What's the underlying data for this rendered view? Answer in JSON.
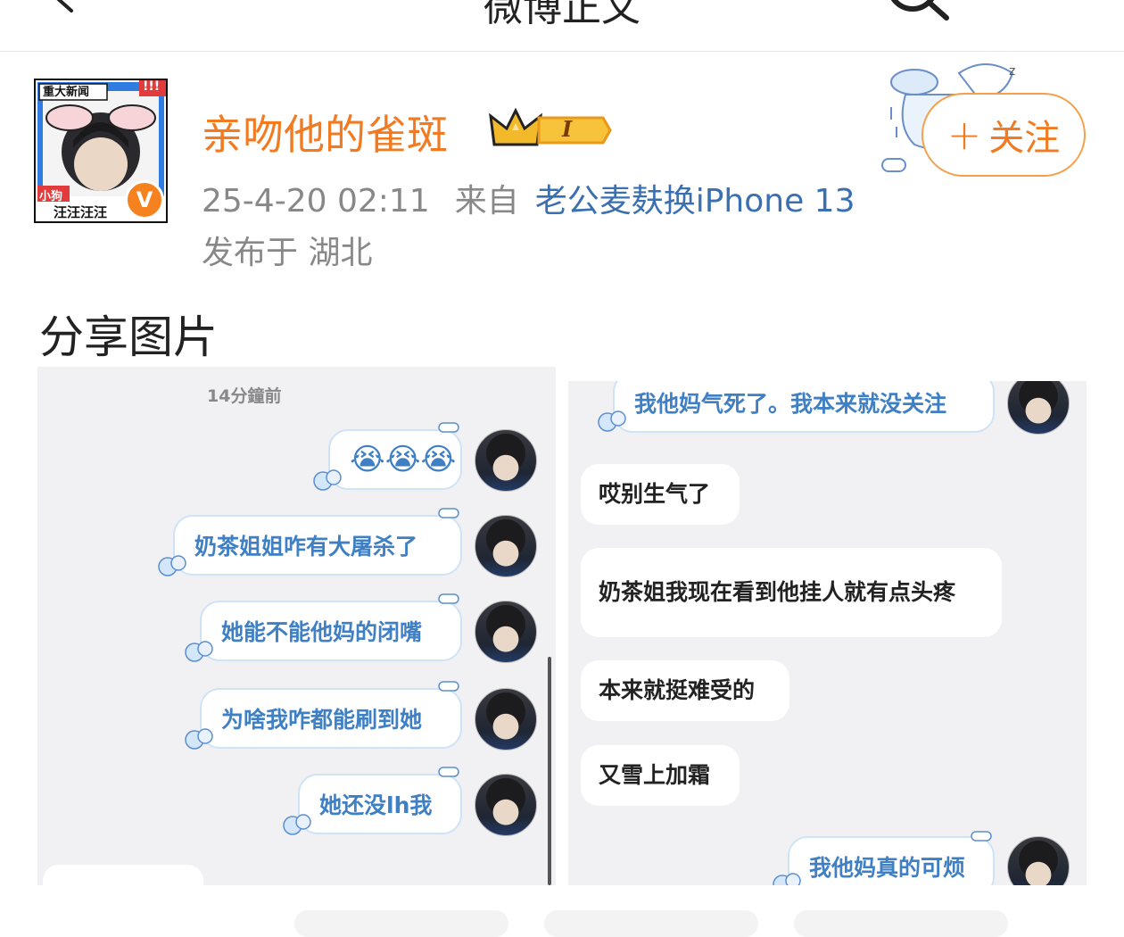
{
  "nav": {
    "title": "微博正文"
  },
  "author": {
    "name": "亲吻他的雀斑",
    "avatar_badge_top": "重大新闻",
    "avatar_badge_alert": "!!!",
    "avatar_tag": "小狗",
    "avatar_caption": "汪汪汪汪",
    "verified_mark": "V",
    "level_mark": "I"
  },
  "post": {
    "datetime": "25-4-20 02:11",
    "source_prefix": "来自",
    "source": "老公麦麸换iPhone 13",
    "location": "发布于 湖北",
    "text": "分享图片"
  },
  "follow_button": {
    "plus": "+",
    "label": "关注"
  },
  "screenshot1": {
    "time_label": "14分鐘前",
    "messages": [
      "😭😭😭",
      "奶茶姐姐咋有大屠杀了",
      "她能不能他妈的闭嘴",
      "为啥我咋都能刷到她",
      "她还没lh我"
    ]
  },
  "screenshot2": {
    "top_message": "我他妈气死了。我本来就没关注",
    "replies": [
      "哎别生气了",
      "奶茶姐我现在看到他挂人就有点头疼",
      "本来就挺难受的",
      "又雪上加霜"
    ],
    "bottom_message": "我他妈真的可烦"
  },
  "colors": {
    "accent": "#f27b22",
    "link": "#3a6fb0",
    "bubble_text": "#3f7fc4"
  }
}
